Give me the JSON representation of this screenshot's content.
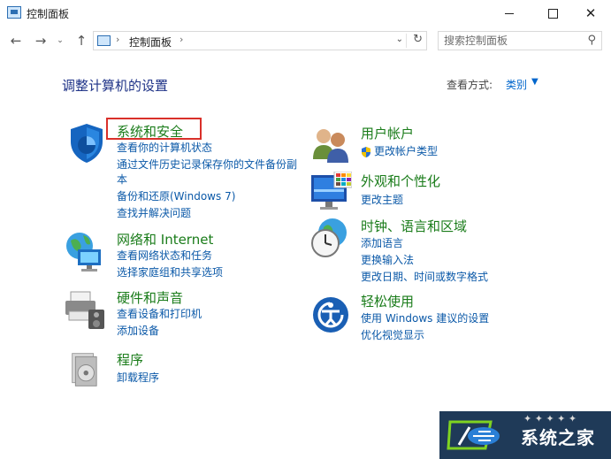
{
  "window": {
    "title": "控制面板"
  },
  "titlebar": {
    "minimize_icon": "minimize-icon",
    "maximize_icon": "maximize-icon",
    "close_icon": "close-icon"
  },
  "address_bar": {
    "breadcrumb": [
      "控制面板"
    ],
    "separator": "›"
  },
  "search": {
    "placeholder": "搜索控制面板"
  },
  "main": {
    "heading": "调整计算机的设置",
    "view_by_label": "查看方式:",
    "view_by_value": "类别"
  },
  "categories_left": [
    {
      "title": "系统和安全",
      "icon": "shield-icon",
      "links": [
        "查看你的计算机状态",
        "通过文件历史记录保存你的文件备份副",
        "本",
        "备份和还原(Windows 7)",
        "查找并解决问题"
      ]
    },
    {
      "title": "网络和 Internet",
      "icon": "network-globe-icon",
      "links": [
        "查看网络状态和任务",
        "选择家庭组和共享选项"
      ]
    },
    {
      "title": "硬件和声音",
      "icon": "printer-icon",
      "links": [
        "查看设备和打印机",
        "添加设备"
      ]
    },
    {
      "title": "程序",
      "icon": "programs-icon",
      "links": [
        "卸载程序"
      ]
    }
  ],
  "categories_right": [
    {
      "title": "用户帐户",
      "icon": "users-icon",
      "links": [
        "更改帐户类型"
      ]
    },
    {
      "title": "外观和个性化",
      "icon": "monitor-icon",
      "links": [
        "更改主题"
      ]
    },
    {
      "title": "时钟、语言和区域",
      "icon": "clock-globe-icon",
      "links": [
        "添加语言",
        "更换输入法",
        "更改日期、时间或数字格式"
      ]
    },
    {
      "title": "轻松使用",
      "icon": "ease-of-access-icon",
      "links": [
        "使用 Windows 建议的设置",
        "优化视觉显示"
      ]
    }
  ],
  "watermark": {
    "text": "系统之家"
  },
  "colors": {
    "category_title": "#1a7c1a",
    "link": "#0b59a8",
    "heading": "#1e3287",
    "highlight": "#d9302a"
  }
}
